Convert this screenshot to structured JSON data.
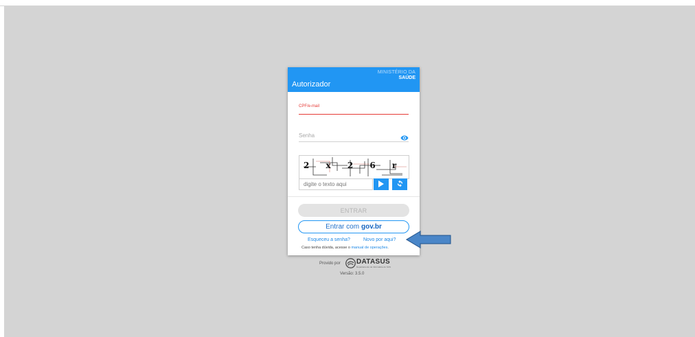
{
  "header": {
    "app_title": "Autorizador",
    "ministry_line1": "MINISTÉRIO DA",
    "ministry_line2": "SAÚDE"
  },
  "form": {
    "cpf_label": "CPF/e-mail",
    "password_label": "Senha",
    "captcha_text": "2 x 2 6 r",
    "captcha_placeholder": "digite o texto aqui",
    "enter_button": "ENTRAR",
    "govbr_prefix": "Entrar com",
    "govbr_brand": "gov.br",
    "forgot_link": "Esqueceu a senha?",
    "new_link": "Novo por aqui?",
    "help_text": "Caso tenha dúvida, acesse o",
    "help_link": "manual de operações",
    "help_end": "."
  },
  "footer": {
    "provided_by": "Provido por",
    "logo_name": "DATASUS",
    "logo_subtitle": "Departamento de Informática do SUS",
    "version": "Versão: 3.5.0"
  },
  "icons": {
    "password_toggle": "eye-icon",
    "audio_captcha": "play-icon",
    "refresh_captcha": "refresh-icon",
    "annotation": "arrow-left-icon"
  },
  "colors": {
    "primary": "#2196f3",
    "error": "#e53935",
    "background": "#d4d4d4",
    "annotation_arrow": "#4a86c8"
  }
}
